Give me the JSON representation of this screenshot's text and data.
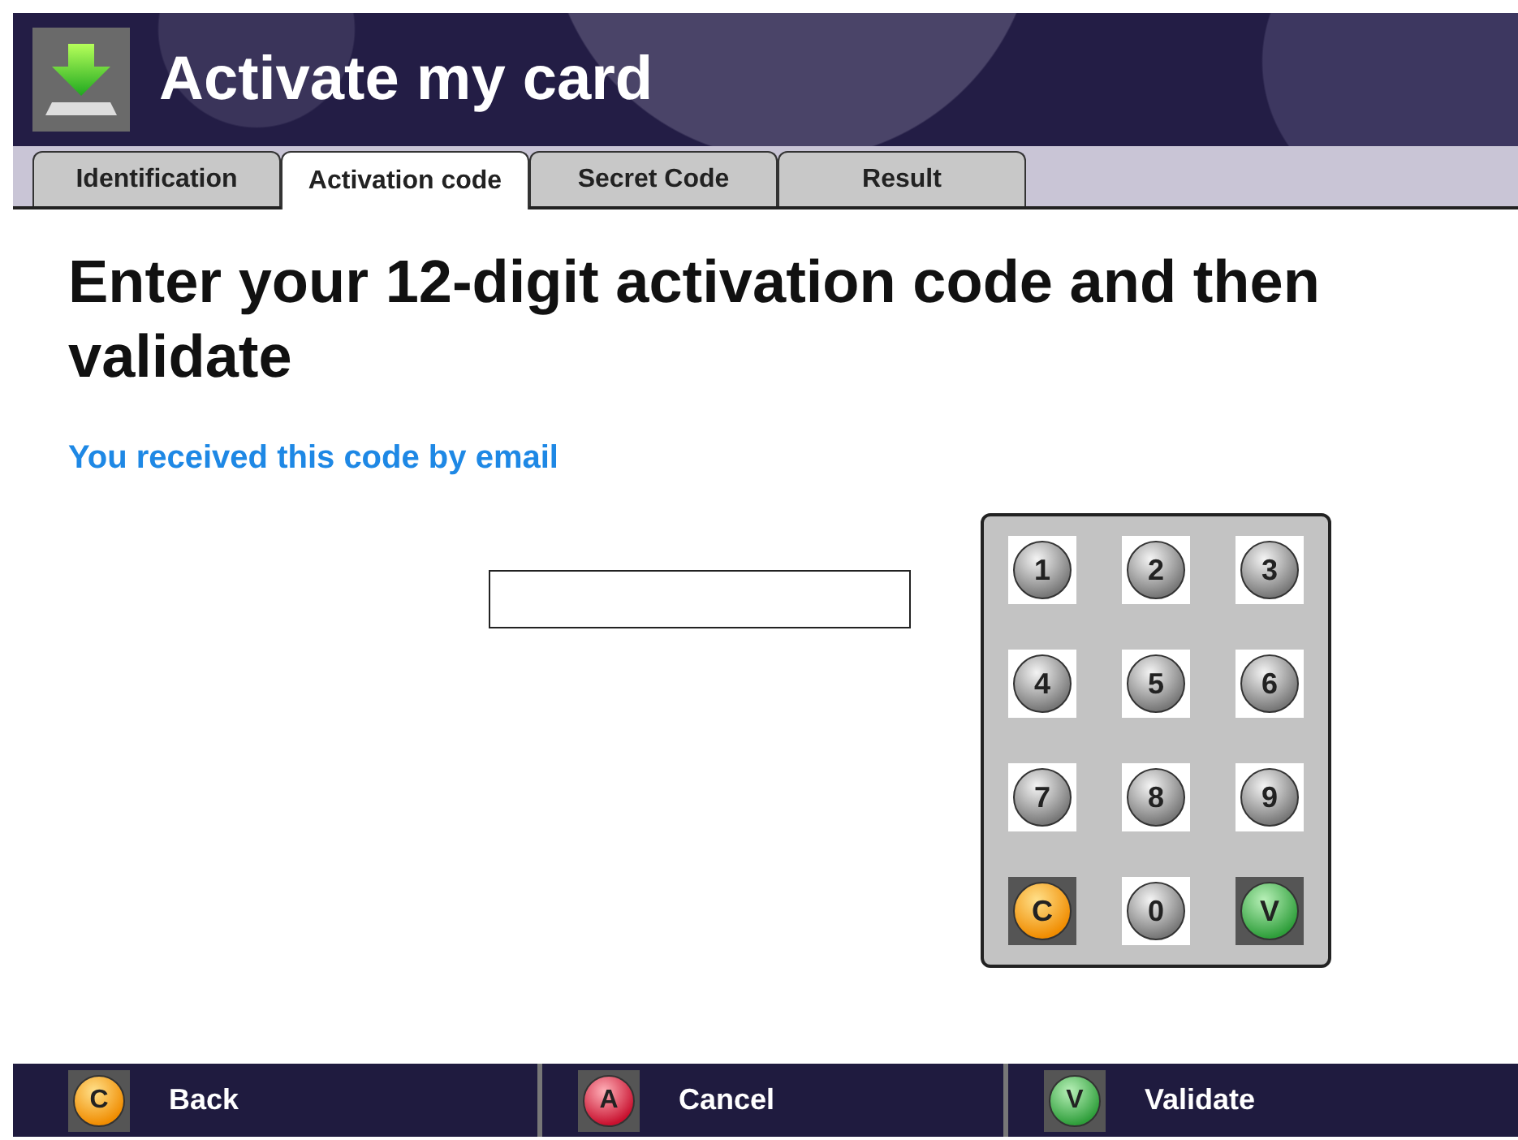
{
  "window": {
    "title": "Activate my card"
  },
  "tabs": [
    {
      "label": "Identification",
      "selected": false
    },
    {
      "label": "Activation code",
      "selected": true
    },
    {
      "label": "Secret Code",
      "selected": false
    },
    {
      "label": "Result",
      "selected": false
    }
  ],
  "heading": "Enter your 12-digit activation code and then validate",
  "hint": "You received this code by email",
  "keypad": [
    {
      "label": "1",
      "kind": "digit"
    },
    {
      "label": "2",
      "kind": "digit"
    },
    {
      "label": "3",
      "kind": "digit"
    },
    {
      "label": "4",
      "kind": "digit"
    },
    {
      "label": "5",
      "kind": "digit"
    },
    {
      "label": "6",
      "kind": "digit"
    },
    {
      "label": "7",
      "kind": "digit"
    },
    {
      "label": "8",
      "kind": "digit"
    },
    {
      "label": "9",
      "kind": "digit"
    },
    {
      "label": "C",
      "kind": "clear"
    },
    {
      "label": "0",
      "kind": "digit"
    },
    {
      "label": "V",
      "kind": "validate"
    }
  ],
  "footer": [
    {
      "key": "C",
      "label": "Back",
      "kind": "clear"
    },
    {
      "key": "A",
      "label": "Cancel",
      "kind": "cancel"
    },
    {
      "key": "V",
      "label": "Validate",
      "kind": "validate"
    }
  ]
}
